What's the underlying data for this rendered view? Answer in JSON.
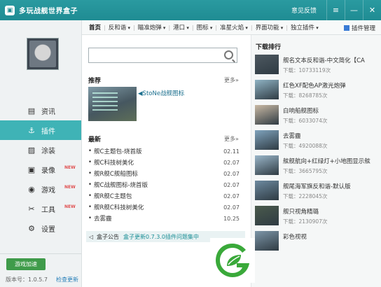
{
  "window": {
    "title": "多玩战舰世界盒子",
    "feedback_label": "意见反馈",
    "menu_glyph": "≡",
    "minimize_glyph": "—",
    "close_glyph": "✕"
  },
  "sidebar": {
    "items": [
      {
        "label": "资讯",
        "icon": "news-icon",
        "glyph": "▤",
        "active": false,
        "hot": ""
      },
      {
        "label": "插件",
        "icon": "anchor-icon",
        "glyph": "⚓",
        "active": true,
        "hot": ""
      },
      {
        "label": "涂装",
        "icon": "paint-icon",
        "glyph": "▨",
        "active": false,
        "hot": ""
      },
      {
        "label": "录像",
        "icon": "video-icon",
        "glyph": "▣",
        "active": false,
        "hot": "NEW"
      },
      {
        "label": "游戏",
        "icon": "gamepad-icon",
        "glyph": "◉",
        "active": false,
        "hot": "NEW"
      },
      {
        "label": "工具",
        "icon": "tools-icon",
        "glyph": "✂",
        "active": false,
        "hot": "NEW"
      },
      {
        "label": "设置",
        "icon": "gear-icon",
        "glyph": "⚙",
        "active": false,
        "hot": ""
      }
    ],
    "speed_button": "游戏加速",
    "version": "版本号：1.0.5.7",
    "check_update": "检查更新"
  },
  "nav": {
    "tabs": [
      {
        "label": "首页",
        "active": true,
        "arrow": false
      },
      {
        "label": "反和谐",
        "active": false,
        "arrow": true
      },
      {
        "label": "瞄准炮弹",
        "active": false,
        "arrow": true
      },
      {
        "label": "港口",
        "active": false,
        "arrow": true
      },
      {
        "label": "图标",
        "active": false,
        "arrow": true
      },
      {
        "label": "准星火焰",
        "active": false,
        "arrow": true
      },
      {
        "label": "界面功能",
        "active": false,
        "arrow": true
      },
      {
        "label": "独立插件",
        "active": false,
        "arrow": true
      }
    ],
    "plugin_manager": "插件管理"
  },
  "search": {
    "placeholder": ""
  },
  "recommend": {
    "title": "推荐",
    "more": "更多»",
    "item": "StoNe战舰图标"
  },
  "latest": {
    "title": "最新",
    "more": "更多»",
    "items": [
      {
        "title": "舰C主题包-烧首版",
        "date": "02.11"
      },
      {
        "title": "舰C科技树美化",
        "date": "02.07"
      },
      {
        "title": "舰R舰C舰船图标",
        "date": "02.07"
      },
      {
        "title": "舰C战舰图标-烧首版",
        "date": "02.07"
      },
      {
        "title": "舰R舰C主题包",
        "date": "02.07"
      },
      {
        "title": "舰R舰C科技树美化",
        "date": "02.07"
      },
      {
        "title": "去雾霾",
        "date": "10.25"
      }
    ]
  },
  "notice": {
    "label": "盒子公告",
    "message": "盒子更新0.7.3.0插件问题集中"
  },
  "downloads": {
    "title": "下载排行",
    "items": [
      {
        "name": "舰名文本反和谐-中文简化【CA",
        "count": "下载：10733119次",
        "thumb": "#4d5860"
      },
      {
        "name": "红色XF配色AP激光炮弹",
        "count": "下载：8268785次",
        "thumb": "#8fb3c4"
      },
      {
        "name": "白响船舰图标",
        "count": "下载：6033074次",
        "thumb": "#c9b9a4"
      },
      {
        "name": "去雾霾",
        "count": "下载：4920088次",
        "thumb": "#7fa3bd"
      },
      {
        "name": "舷舰航向+红绿灯+小地图显示舷",
        "count": "下载：3665795次",
        "thumb": "#9ab6c9"
      },
      {
        "name": "舰尾海军旗反和谐-默认版",
        "count": "下载：2228045次",
        "thumb": "#6d8aa0"
      },
      {
        "name": "舰只视角精璐",
        "count": "下载：2130907次",
        "thumb": "#4a5a4c"
      },
      {
        "name": "彩色视视",
        "count": "",
        "thumb": "#7d96a8"
      }
    ]
  },
  "colors": {
    "titlebar": "#1f8c93",
    "accent": "#3fb3b6",
    "brand_green": "#3aa93a"
  }
}
